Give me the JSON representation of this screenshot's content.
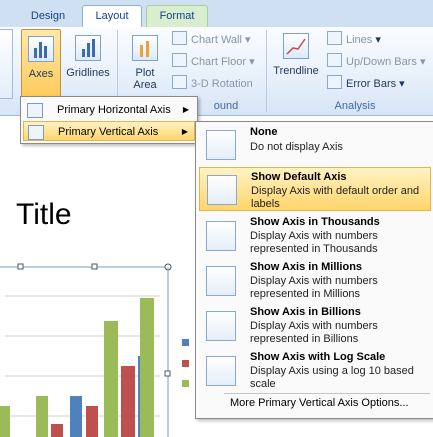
{
  "tabs": [
    {
      "label": "Design"
    },
    {
      "label": "Layout"
    },
    {
      "label": "Format"
    }
  ],
  "ribbon": {
    "axes_label": "Axes",
    "gridlines_label": "Gridlines",
    "plot_area_label": "Plot Area",
    "chart_wall_label": "Chart Wall",
    "chart_floor_label": "Chart Floor",
    "rotation_label": "3-D Rotation",
    "trendline_label": "Trendline",
    "lines_label": "Lines",
    "updown_label": "Up/Down Bars",
    "errorbars_label": "Error Bars",
    "group_background_partial": "ound",
    "group_analysis": "Analysis"
  },
  "submenu": {
    "horizontal_label": "Primary Horizontal Axis",
    "vertical_label": "Primary Vertical Axis"
  },
  "axis_menu": {
    "items": [
      {
        "title": "None",
        "desc": "Do not display Axis",
        "icon": "no-axis-icon"
      },
      {
        "title": "Show Default Axis",
        "desc": "Display Axis with default order and labels",
        "icon": "default-axis-icon"
      },
      {
        "title": "Show Axis in Thousands",
        "desc": "Display Axis with numbers represented in Thousands",
        "icon": "thousands-axis-icon"
      },
      {
        "title": "Show Axis in Millions",
        "desc": "Display Axis with numbers represented in Millions",
        "icon": "millions-axis-icon"
      },
      {
        "title": "Show Axis in Billions",
        "desc": "Display Axis with numbers represented in Billions",
        "icon": "billions-axis-icon"
      },
      {
        "title": "Show Axis with Log Scale",
        "desc": "Display Axis using a log 10 based scale",
        "icon": "log-axis-icon"
      }
    ],
    "more_options": "More Primary Vertical Axis Options..."
  },
  "chart": {
    "title": "Title"
  },
  "colors": {
    "series1": "#4f81bd",
    "series2": "#c0504d",
    "series3": "#9bbb59",
    "highlight": "#ffd56b"
  }
}
